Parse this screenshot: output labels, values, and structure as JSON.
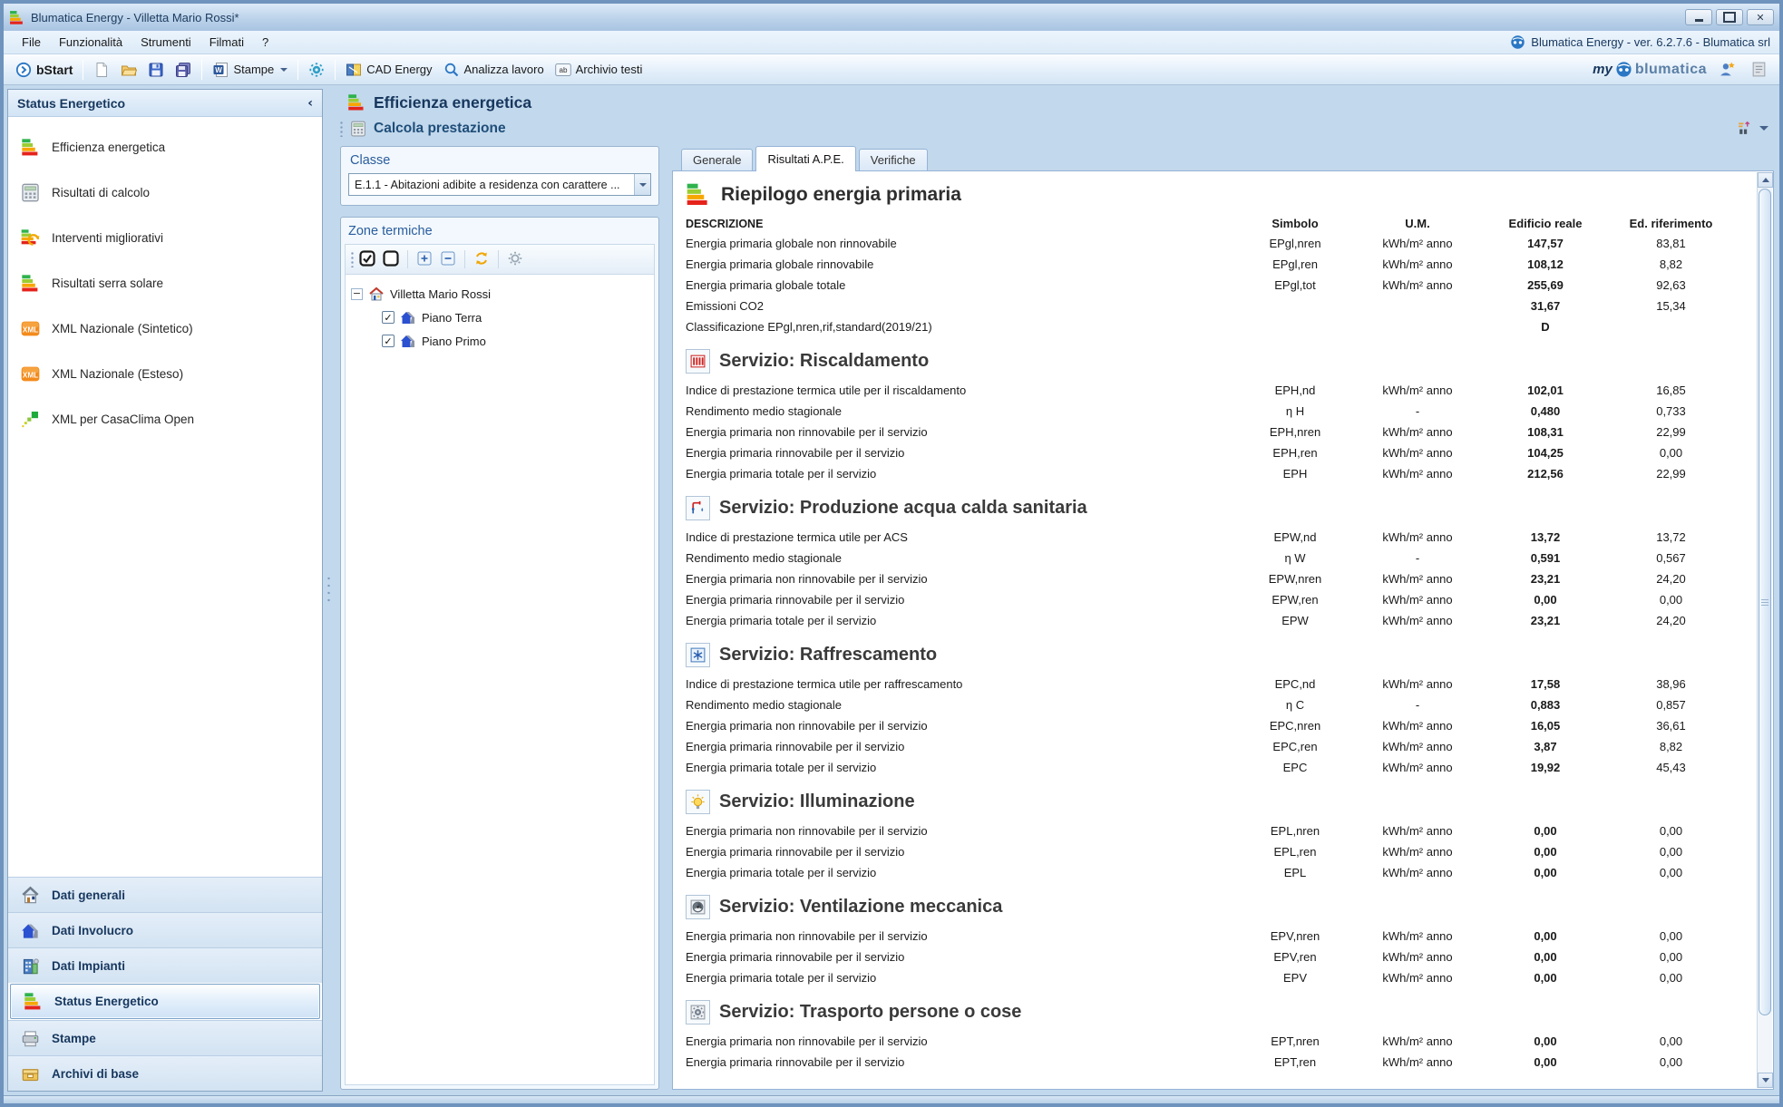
{
  "theme": {
    "accent": "#2a77c4",
    "chrome_blue": "#bcd3ea",
    "header_text": "#17375e",
    "energy_green": "#2eb24c",
    "energy_red": "#e5231b"
  },
  "window": {
    "title": "Blumatica Energy - Villetta Mario Rossi*",
    "controls": [
      "minimize",
      "maximize",
      "close"
    ]
  },
  "menu": {
    "items": [
      {
        "name": "file",
        "label": "File"
      },
      {
        "name": "funzionalita",
        "label": "Funzionalità"
      },
      {
        "name": "strumenti",
        "label": "Strumenti"
      },
      {
        "name": "filmati",
        "label": "Filmati"
      },
      {
        "name": "help",
        "label": "?"
      }
    ],
    "version_text": "Blumatica Energy - ver. 6.2.7.6 - Blumatica srl"
  },
  "toolbar": {
    "items": [
      {
        "name": "bstart",
        "icon": "bstart-circle",
        "label": "bStart"
      },
      {
        "sep": true
      },
      {
        "name": "new-file",
        "icon": "new-doc"
      },
      {
        "name": "open-file",
        "icon": "open-folder"
      },
      {
        "name": "save",
        "icon": "floppy"
      },
      {
        "name": "save-all",
        "icon": "floppy-multi"
      },
      {
        "sep": true
      },
      {
        "name": "stampe",
        "icon": "word-doc",
        "label": "Stampe",
        "dropdown": true
      },
      {
        "sep": true
      },
      {
        "name": "settings",
        "icon": "gear-teal"
      },
      {
        "sep": true
      },
      {
        "name": "cad-energy",
        "icon": "cad",
        "label": "CAD Energy"
      },
      {
        "name": "analizza-lavoro",
        "icon": "magnifier",
        "label": "Analizza lavoro"
      },
      {
        "name": "archivio-testi",
        "icon": "ab-box",
        "label": "Archivio testi"
      }
    ],
    "brand": {
      "my": "my",
      "name": "blumatica"
    },
    "right_items": [
      {
        "name": "profile",
        "icon": "person-star"
      },
      {
        "name": "notes",
        "icon": "note"
      }
    ]
  },
  "sidebar": {
    "header": "Status Energetico",
    "items": [
      {
        "name": "efficienza-energetica",
        "icon": "energy-bars",
        "label": "Efficienza energetica"
      },
      {
        "name": "risultati-di-calcolo",
        "icon": "calculator",
        "label": "Risultati di calcolo"
      },
      {
        "name": "interventi-migliorativi",
        "icon": "energy-refresh",
        "label": "Interventi migliorativi"
      },
      {
        "name": "risultati-serra-solare",
        "icon": "energy-bars",
        "label": "Risultati serra solare"
      },
      {
        "name": "xml-nazionale-sintetico",
        "icon": "xml-badge",
        "label": "XML Nazionale (Sintetico)"
      },
      {
        "name": "xml-nazionale-esteso",
        "icon": "xml-badge",
        "label": "XML Nazionale (Esteso)"
      },
      {
        "name": "xml-casaclima-open",
        "icon": "casaclima-dots",
        "label": "XML per CasaClima Open"
      }
    ],
    "nav": [
      {
        "name": "dati-generali",
        "icon": "house",
        "label": "Dati generali"
      },
      {
        "name": "dati-involucro",
        "icon": "blue-house",
        "label": "Dati Involucro"
      },
      {
        "name": "dati-impianti",
        "icon": "building",
        "label": "Dati Impianti"
      },
      {
        "name": "status-energetico",
        "icon": "energy-bars",
        "label": "Status Energetico",
        "selected": true
      },
      {
        "name": "stampe",
        "icon": "printer",
        "label": "Stampe"
      },
      {
        "name": "archivi-di-base",
        "icon": "archive",
        "label": "Archivi di base"
      }
    ]
  },
  "workspace": {
    "title": "Efficienza energetica",
    "action": "Calcola prestazione",
    "classe": {
      "label": "Classe",
      "value": "E.1.1 - Abitazioni adibite a residenza con carattere ..."
    },
    "zone": {
      "label": "Zone termiche",
      "toolbar": [
        {
          "name": "check-all-zones",
          "icon": "check-all"
        },
        {
          "name": "uncheck-all-zones",
          "icon": "uncheck-all"
        },
        {
          "sep": true
        },
        {
          "name": "expand-all",
          "icon": "expand-box"
        },
        {
          "name": "collapse-all",
          "icon": "collapse-box"
        },
        {
          "sep": true
        },
        {
          "name": "refresh-zones",
          "icon": "refresh"
        },
        {
          "sep": true
        },
        {
          "name": "zone-settings",
          "icon": "gear-gray"
        }
      ],
      "tree_root": "Villetta Mario Rossi",
      "children": [
        {
          "label": "Piano Terra",
          "checked": true
        },
        {
          "label": "Piano Primo",
          "checked": true
        }
      ]
    }
  },
  "tabs": [
    {
      "name": "generale",
      "label": "Generale"
    },
    {
      "name": "risultati-ape",
      "label": "Risultati A.P.E.",
      "active": true
    },
    {
      "name": "verifiche",
      "label": "Verifiche"
    }
  ],
  "report": {
    "title": "Riepilogo energia primaria",
    "title_icon": "energy-bars",
    "columns": [
      "DESCRIZIONE",
      "Simbolo",
      "U.M.",
      "Edificio reale",
      "Ed. riferimento"
    ],
    "summary_rows": [
      [
        "Energia primaria globale non rinnovabile",
        "EPgl,nren",
        "kWh/m² anno",
        "147,57",
        "83,81"
      ],
      [
        "Energia primaria globale rinnovabile",
        "EPgl,ren",
        "kWh/m² anno",
        "108,12",
        "8,82"
      ],
      [
        "Energia primaria globale totale",
        "EPgl,tot",
        "kWh/m² anno",
        "255,69",
        "92,63"
      ],
      [
        "Emissioni CO2",
        "",
        "",
        "31,67",
        "15,34"
      ],
      [
        "Classificazione EPgl,nren,rif,standard(2019/21)",
        "",
        "",
        "D",
        ""
      ]
    ],
    "sections": [
      {
        "title": "Servizio: Riscaldamento",
        "icon": "radiator",
        "rows": [
          [
            "Indice di prestazione termica utile per il riscaldamento",
            "EPH,nd",
            "kWh/m² anno",
            "102,01",
            "16,85"
          ],
          [
            "Rendimento medio stagionale",
            "η H",
            "-",
            "0,480",
            "0,733"
          ],
          [
            "Energia primaria non rinnovabile per il servizio",
            "EPH,nren",
            "kWh/m² anno",
            "108,31",
            "22,99"
          ],
          [
            "Energia primaria rinnovabile per il servizio",
            "EPH,ren",
            "kWh/m² anno",
            "104,25",
            "0,00"
          ],
          [
            "Energia primaria totale per il servizio",
            "EPH",
            "kWh/m² anno",
            "212,56",
            "22,99"
          ]
        ]
      },
      {
        "title": "Servizio: Produzione acqua calda sanitaria",
        "icon": "faucet",
        "rows": [
          [
            "Indice di prestazione termica utile per ACS",
            "EPW,nd",
            "kWh/m² anno",
            "13,72",
            "13,72"
          ],
          [
            "Rendimento medio stagionale",
            "η W",
            "-",
            "0,591",
            "0,567"
          ],
          [
            "Energia primaria non rinnovabile per il servizio",
            "EPW,nren",
            "kWh/m² anno",
            "23,21",
            "24,20"
          ],
          [
            "Energia primaria rinnovabile per il servizio",
            "EPW,ren",
            "kWh/m² anno",
            "0,00",
            "0,00"
          ],
          [
            "Energia primaria totale per il servizio",
            "EPW",
            "kWh/m² anno",
            "23,21",
            "24,20"
          ]
        ]
      },
      {
        "title": "Servizio: Raffrescamento",
        "icon": "cooling",
        "rows": [
          [
            "Indice di prestazione termica utile per raffrescamento",
            "EPC,nd",
            "kWh/m² anno",
            "17,58",
            "38,96"
          ],
          [
            "Rendimento medio stagionale",
            "η C",
            "-",
            "0,883",
            "0,857"
          ],
          [
            "Energia primaria non rinnovabile per il servizio",
            "EPC,nren",
            "kWh/m² anno",
            "16,05",
            "36,61"
          ],
          [
            "Energia primaria rinnovabile per il servizio",
            "EPC,ren",
            "kWh/m² anno",
            "3,87",
            "8,82"
          ],
          [
            "Energia primaria totale per il servizio",
            "EPC",
            "kWh/m² anno",
            "19,92",
            "45,43"
          ]
        ]
      },
      {
        "title": "Servizio: Illuminazione",
        "icon": "bulb",
        "rows": [
          [
            "Energia primaria non rinnovabile per il servizio",
            "EPL,nren",
            "kWh/m² anno",
            "0,00",
            "0,00"
          ],
          [
            "Energia primaria rinnovabile per il servizio",
            "EPL,ren",
            "kWh/m² anno",
            "0,00",
            "0,00"
          ],
          [
            "Energia primaria totale per il servizio",
            "EPL",
            "kWh/m² anno",
            "0,00",
            "0,00"
          ]
        ]
      },
      {
        "title": "Servizio: Ventilazione meccanica",
        "icon": "fan",
        "rows": [
          [
            "Energia primaria non rinnovabile per il servizio",
            "EPV,nren",
            "kWh/m² anno",
            "0,00",
            "0,00"
          ],
          [
            "Energia primaria rinnovabile per il servizio",
            "EPV,ren",
            "kWh/m² anno",
            "0,00",
            "0,00"
          ],
          [
            "Energia primaria totale per il servizio",
            "EPV",
            "kWh/m² anno",
            "0,00",
            "0,00"
          ]
        ]
      },
      {
        "title": "Servizio: Trasporto persone o cose",
        "icon": "gear-box",
        "rows": [
          [
            "Energia primaria non rinnovabile per il servizio",
            "EPT,nren",
            "kWh/m² anno",
            "0,00",
            "0,00"
          ],
          [
            "Energia primaria rinnovabile per il servizio",
            "EPT,ren",
            "kWh/m² anno",
            "0,00",
            "0,00"
          ]
        ]
      }
    ]
  }
}
